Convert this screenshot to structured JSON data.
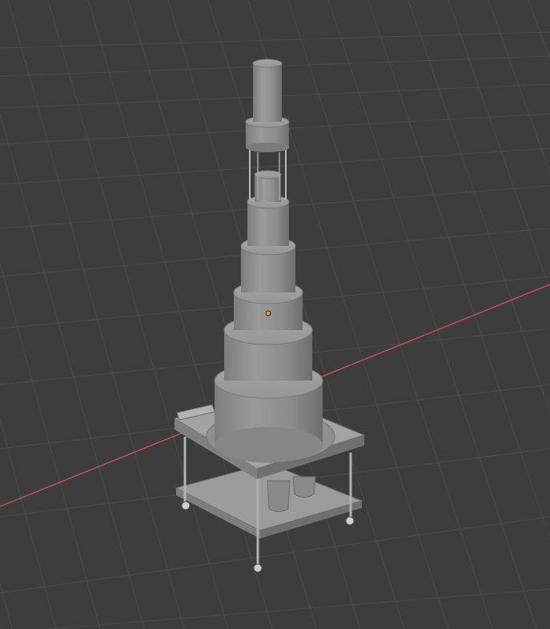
{
  "app": {
    "view": "3d-viewport"
  },
  "viewport": {
    "background_color": "#3d3d3d",
    "grid_color": "#4a4a4a",
    "x_axis_color": "#c24d5a",
    "origin_color": "#f0902a",
    "grid_visible": true
  },
  "scene": {
    "object_type": "tiered-cylinder-tower-on-cart",
    "object_color": "#8f8f8f",
    "selected_origin_visible": true
  }
}
